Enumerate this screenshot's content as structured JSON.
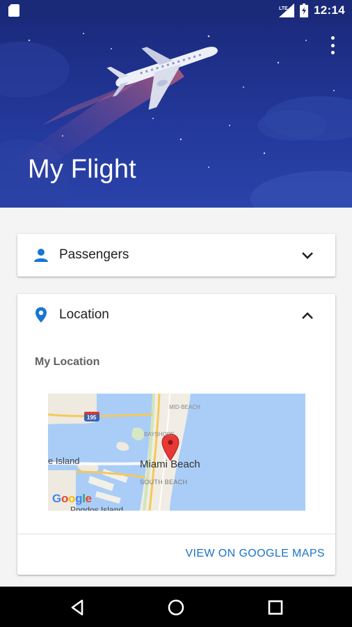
{
  "status_bar": {
    "time": "12:14",
    "network_label": "LTE",
    "icons": [
      "sim-card-icon",
      "signal-icon",
      "battery-icon"
    ]
  },
  "header": {
    "title": "My Flight",
    "menu_icon": "overflow-menu-icon"
  },
  "cards": {
    "passengers": {
      "label": "Passengers",
      "icon": "person-icon",
      "state_icon": "chevron-down-icon"
    },
    "location": {
      "label": "Location",
      "icon": "location-pin-icon",
      "state_icon": "chevron-up-icon",
      "section_label": "My Location",
      "map": {
        "labels": {
          "city": "Miami Beach",
          "south_beach": "SOUTH BEACH",
          "mid_beach": "MID-BEACH",
          "bayshore": "BAYSHORE",
          "island": "e Island",
          "partial_island": "Pogdos Island",
          "highway": "195",
          "logo": "Google"
        }
      },
      "action_label": "VIEW ON GOOGLE MAPS"
    }
  },
  "navigation": {
    "back": "back-icon",
    "home": "home-icon",
    "recents": "recents-icon"
  },
  "colors": {
    "header": "#23389a",
    "accent": "#1976d2",
    "link": "#1a73c8",
    "map_water": "#a9cdf7",
    "map_pin": "#e53935"
  }
}
